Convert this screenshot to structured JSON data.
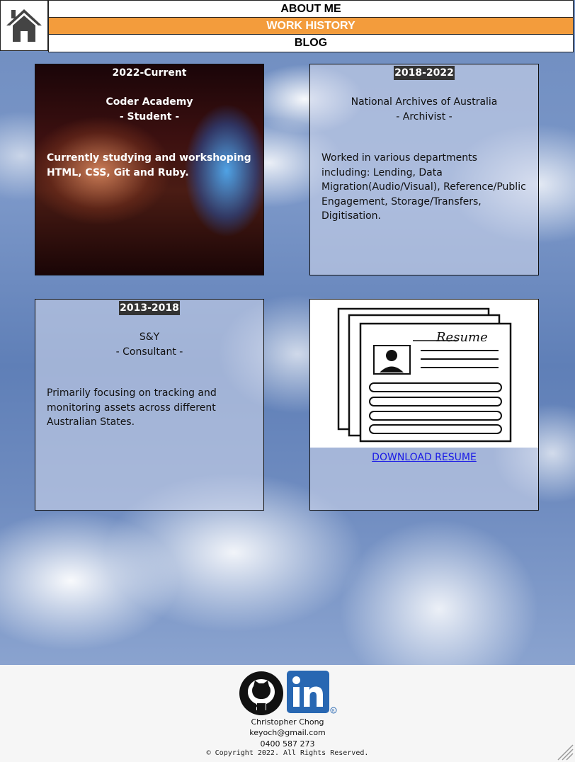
{
  "nav": {
    "items": [
      {
        "label": "ABOUT ME"
      },
      {
        "label": "WORK HISTORY"
      },
      {
        "label": "BLOG"
      }
    ],
    "active_index": 1,
    "active_color": "#f39c3c"
  },
  "jobs": [
    {
      "period": "2022-Current",
      "organisation": "Coder Academy",
      "role": "- Student -",
      "description": "Currently studying and workshoping HTML, CSS, Git and Ruby."
    },
    {
      "period": "2018-2022",
      "organisation": "National Archives of Australia",
      "role": "- Archivist -",
      "description": "Worked in various departments including: Lending, Data Migration(Audio/Visual), Reference/Public Engagement, Storage/Transfers, Digitisation."
    },
    {
      "period": "2013-2018",
      "organisation": "S&Y",
      "role": "- Consultant -",
      "description": "Primarily focusing on tracking and monitoring assets across different Australian States."
    }
  ],
  "resume": {
    "image_caption": "Resume",
    "download_label": "DOWNLOAD RESUME"
  },
  "footer": {
    "name": "Christopher Chong",
    "email": "keyoch@gmail.com",
    "phone": "0400 587 273",
    "copyright": "© Copyright 2022. All Rights Reserved.",
    "icons": [
      "github-icon",
      "linkedin-icon"
    ]
  }
}
